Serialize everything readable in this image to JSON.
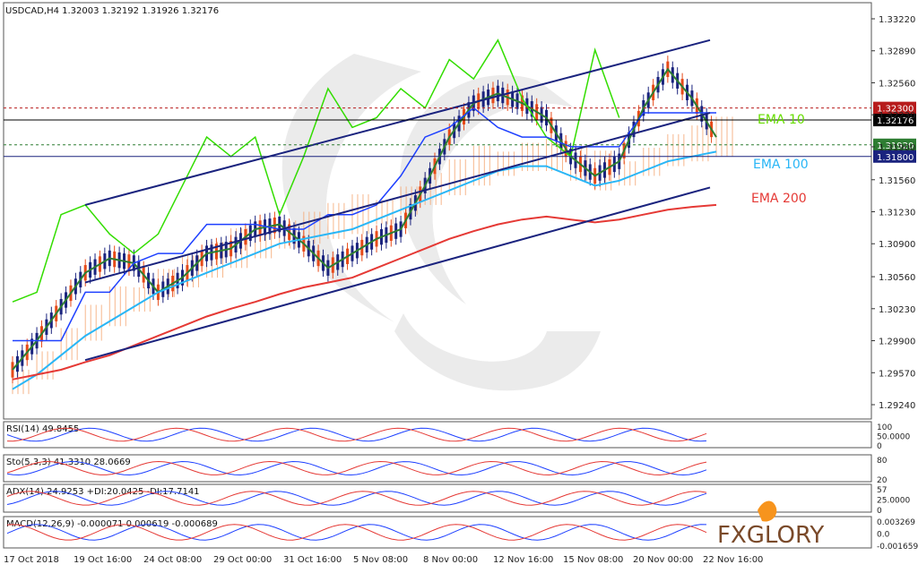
{
  "chart_data": {
    "type": "line",
    "symbol_header": "USDCAD,H4  1.32003 1.32192 1.31926 1.32176",
    "price_axis": {
      "ticks": [
        "1.33220",
        "1.32890",
        "1.32560",
        "1.32230",
        "1.31900",
        "1.31560",
        "1.31230",
        "1.30900",
        "1.30560",
        "1.30230",
        "1.29900",
        "1.29570",
        "1.29240"
      ],
      "range": [
        1.2924,
        1.3322
      ]
    },
    "price_levels": [
      {
        "label": "1.32300",
        "value": 1.323,
        "color": "#b71c1c",
        "style": "dotted"
      },
      {
        "label": "1.32176",
        "value": 1.32176,
        "color": "#000000",
        "style": "solid"
      },
      {
        "label": "1.31920",
        "value": 1.3192,
        "color": "#2e7d32",
        "style": "dotted"
      },
      {
        "label": "1.31800",
        "value": 1.318,
        "color": "#1a237e",
        "style": "solid"
      }
    ],
    "time_labels": [
      "17 Oct 2018",
      "19 Oct 16:00",
      "24 Oct 08:00",
      "29 Oct 00:00",
      "31 Oct 16:00",
      "5 Nov 08:00",
      "8 Nov 00:00",
      "12 Nov 16:00",
      "15 Nov 08:00",
      "20 Nov 00:00",
      "22 Nov 16:00"
    ],
    "ema_labels": [
      {
        "text": "EMA 10",
        "color": "#66dd00"
      },
      {
        "text": "EMA 100",
        "color": "#29b6f6"
      },
      {
        "text": "EMA 200",
        "color": "#e53935"
      }
    ],
    "series": [
      {
        "name": "EMA 10",
        "color": "#2e7d32",
        "values": [
          1.296,
          1.299,
          1.3025,
          1.306,
          1.3075,
          1.307,
          1.304,
          1.3055,
          1.308,
          1.3085,
          1.3105,
          1.311,
          1.309,
          1.3065,
          1.308,
          1.3095,
          1.3105,
          1.315,
          1.32,
          1.3235,
          1.3245,
          1.3235,
          1.322,
          1.318,
          1.316,
          1.3175,
          1.323,
          1.327,
          1.324,
          1.32
        ]
      },
      {
        "name": "EMA 100",
        "color": "#29b6f6",
        "values": [
          1.294,
          1.2955,
          1.2975,
          1.2995,
          1.301,
          1.3025,
          1.304,
          1.305,
          1.306,
          1.307,
          1.308,
          1.309,
          1.3095,
          1.31,
          1.3105,
          1.3115,
          1.3125,
          1.3135,
          1.3145,
          1.3155,
          1.3165,
          1.317,
          1.317,
          1.316,
          1.315,
          1.3155,
          1.3165,
          1.3175,
          1.318,
          1.3185
        ]
      },
      {
        "name": "EMA 200",
        "color": "#e53935",
        "values": [
          1.295,
          1.2955,
          1.296,
          1.2968,
          1.2975,
          1.2985,
          1.2995,
          1.3005,
          1.3015,
          1.3023,
          1.303,
          1.3038,
          1.3045,
          1.305,
          1.3055,
          1.3065,
          1.3075,
          1.3085,
          1.3095,
          1.3103,
          1.311,
          1.3115,
          1.3118,
          1.3115,
          1.3112,
          1.3115,
          1.312,
          1.3125,
          1.3128,
          1.313
        ]
      },
      {
        "name": "Ichimoku Lagging",
        "color": "#33dd00",
        "values": [
          1.303,
          1.304,
          1.312,
          1.313,
          1.31,
          1.308,
          1.31,
          1.315,
          1.32,
          1.318,
          1.32,
          1.312,
          1.318,
          1.325,
          1.321,
          1.322,
          1.325,
          1.323,
          1.328,
          1.326,
          1.33,
          1.324,
          1.32,
          1.318,
          1.329,
          1.322,
          null,
          null,
          null,
          null
        ]
      },
      {
        "name": "Ichimoku Base",
        "color": "#1e40ff",
        "values": [
          1.299,
          1.299,
          1.299,
          1.304,
          1.304,
          1.307,
          1.308,
          1.308,
          1.311,
          1.311,
          1.311,
          1.3105,
          1.3105,
          1.312,
          1.312,
          1.313,
          1.316,
          1.32,
          1.321,
          1.323,
          1.321,
          1.32,
          1.32,
          1.319,
          1.319,
          1.319,
          1.3225,
          1.3225,
          1.3225,
          1.3225
        ]
      }
    ],
    "channel_lines": [
      {
        "from": [
          0.0,
          1.313
        ],
        "to": [
          1.0,
          1.33
        ]
      },
      {
        "from": [
          0.0,
          1.305
        ],
        "to": [
          1.0,
          1.3225
        ]
      },
      {
        "from": [
          0.0,
          1.297
        ],
        "to": [
          1.0,
          1.3148
        ]
      }
    ],
    "subpanels": [
      {
        "label": "RSI(14) 49.8455",
        "ticks": [
          "100",
          "50.0000",
          "0"
        ]
      },
      {
        "label": "Sto(5,3,3) 41.3310 28.0669",
        "ticks": [
          "80",
          "20"
        ]
      },
      {
        "label": "ADX(14) 24.9253 +DI:20.0425 -DI:17.7141",
        "ticks": [
          "57",
          "25.0000",
          "0"
        ]
      },
      {
        "label": "MACD(12,26,9) -0.000071 0.000619 -0.000689",
        "ticks": [
          "0.003269",
          "0.0",
          "-0.001659"
        ]
      }
    ],
    "brand": "FXGLORY",
    "grid": false
  }
}
